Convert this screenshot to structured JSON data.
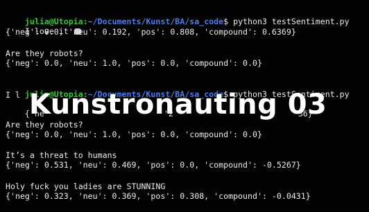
{
  "prompt": {
    "user_host": "julia@Utopia",
    "path": "~/Documents/Kunst/BA/sa_code",
    "symbol": "$"
  },
  "commands": [
    "python3 testSentiment.py",
    "python3 testSentiment.py"
  ],
  "block1": {
    "input_text": "I love it",
    "emoji_icon": "grinning-face-icon",
    "result": "{'neg': 0.0, 'neu': 0.192, 'pos': 0.808, 'compound': 0.6369}",
    "question": "Are they robots?",
    "question_result": "{'neg': 0.0, 'neu': 1.0, 'pos': 0.0, 'compound': 0.0}"
  },
  "block2": {
    "input_fragment": "I l",
    "result_fragment_start": "{'ne",
    "result_fragment_mid": "'2",
    "result_fragment_end": "36",
    "result_fragment_close": "}",
    "question": "Are they robots?",
    "question_result": "{'neg': 0.0, 'neu': 1.0, 'pos': 0.0, 'compound': 0.0}",
    "threat": "It’s a threat to humans",
    "threat_result": "{'neg': 0.531, 'neu': 0.469, 'pos': 0.0, 'compound': -0.5267}",
    "compliment": "Holy fuck you ladies are STUNNING",
    "compliment_result": "{'neg': 0.323, 'neu': 0.369, 'pos': 0.308, 'compound': -0.0431}"
  },
  "overlay": {
    "title": "Kunstronauting 03"
  }
}
